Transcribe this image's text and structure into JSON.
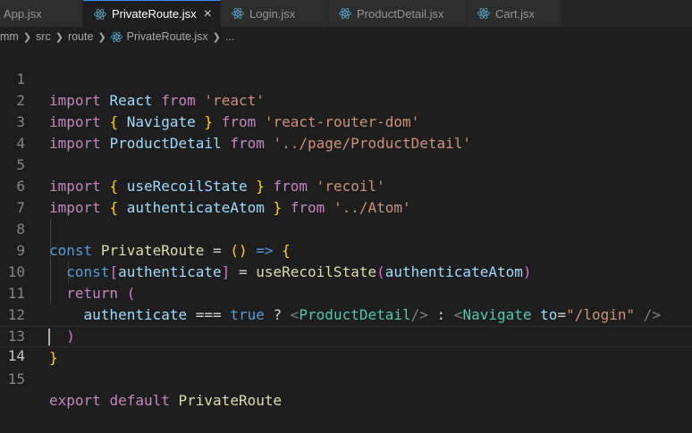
{
  "tabs": [
    {
      "label": "App.jsx",
      "active": false
    },
    {
      "label": "PrivateRoute.jsx",
      "active": true
    },
    {
      "label": "Login.jsx",
      "active": false
    },
    {
      "label": "ProductDetail.jsx",
      "active": false
    },
    {
      "label": "Cart.jsx",
      "active": false
    }
  ],
  "tab_close_glyph": "×",
  "breadcrumb": {
    "root": "mm",
    "folder1": "src",
    "folder2": "route",
    "file": "PrivateRoute.jsx",
    "more": "..."
  },
  "icons": {
    "react": "react-icon",
    "close": "close-icon",
    "chevron": "chevron-right-icon"
  },
  "colors": {
    "keyword": "#569cd6",
    "control": "#c586c0",
    "variable": "#9cdcfe",
    "function": "#dcdcaa",
    "string": "#ce9178",
    "component": "#4ec9b0",
    "react_icon": "#519aba"
  },
  "line_numbers": [
    "1",
    "2",
    "3",
    "4",
    "5",
    "6",
    "7",
    "8",
    "9",
    "10",
    "11",
    "12",
    "13",
    "14",
    "15"
  ],
  "code": {
    "l1": {
      "import": "import",
      "name": "React",
      "from": "from",
      "src": "'react'"
    },
    "l2": {
      "import": "import",
      "open": "{",
      "name": "Navigate",
      "close": "}",
      "from": "from",
      "src": "'react-router-dom'"
    },
    "l3": {
      "import": "import",
      "name": "ProductDetail",
      "from": "from",
      "src": "'../page/ProductDetail'"
    },
    "l5": {
      "import": "import",
      "open": "{",
      "name": "useRecoilState",
      "close": "}",
      "from": "from",
      "src": "'recoil'"
    },
    "l6": {
      "import": "import",
      "open": "{",
      "name": "authenticateAtom",
      "close": "}",
      "from": "from",
      "src": "'../Atom'"
    },
    "l8": {
      "const": "const",
      "name": "PrivateRoute",
      "eq": "=",
      "paren_open": "(",
      "paren_close": ")",
      "arrow": "=>",
      "brace": "{"
    },
    "l9": {
      "const": "const",
      "bopen": "[",
      "name": "authenticate",
      "bclose": "]",
      "eq": "=",
      "fn": "useRecoilState",
      "popen": "(",
      "arg": "authenticateAtom",
      "pclose": ")"
    },
    "l10": {
      "return": "return",
      "paren": "("
    },
    "l11": {
      "name": "authenticate",
      "op": "===",
      "bool": "true",
      "q": "?",
      "lt1": "<",
      "comp1": "ProductDetail",
      "end1": "/>",
      "colon": ":",
      "lt2": "<",
      "comp2": "Navigate",
      "attr": "to",
      "eq": "=",
      "val": "\"/login\"",
      "end2": "/>"
    },
    "l12": {
      "paren": ")"
    },
    "l13": {
      "brace": "}"
    },
    "l15": {
      "export": "export",
      "default": "default",
      "name": "PrivateRoute"
    }
  }
}
